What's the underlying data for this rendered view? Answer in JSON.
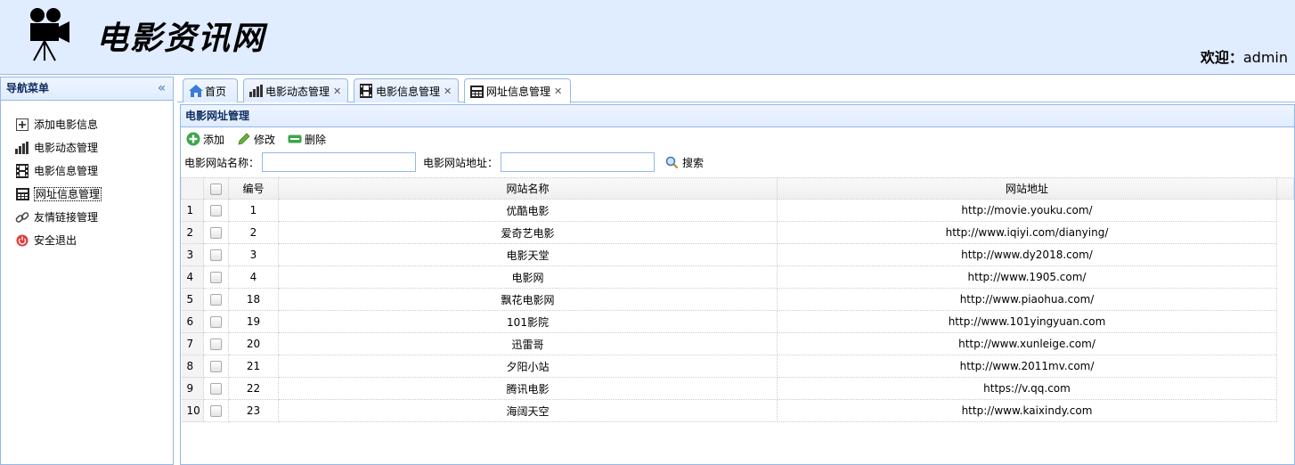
{
  "header": {
    "logo_text": "电影资讯网",
    "welcome_label": "欢迎：",
    "username": "admin"
  },
  "sidebar": {
    "title": "导航菜单",
    "items": [
      {
        "label": "添加电影信息",
        "icon": "add-icon"
      },
      {
        "label": "电影动态管理",
        "icon": "bar-chart-icon"
      },
      {
        "label": "电影信息管理",
        "icon": "film-icon"
      },
      {
        "label": "网址信息管理",
        "icon": "calculator-icon"
      },
      {
        "label": "友情链接管理",
        "icon": "link-icon"
      },
      {
        "label": "安全退出",
        "icon": "exit-icon"
      }
    ]
  },
  "tabs": [
    {
      "label": "首页",
      "icon": "home-icon",
      "closable": false
    },
    {
      "label": "电影动态管理",
      "icon": "bar-chart-icon",
      "closable": true
    },
    {
      "label": "电影信息管理",
      "icon": "film-icon",
      "closable": true
    },
    {
      "label": "网址信息管理",
      "icon": "calculator-icon",
      "closable": true,
      "selected": true
    }
  ],
  "panel": {
    "title": "电影网址管理",
    "toolbar": {
      "add": "添加",
      "edit": "修改",
      "delete": "删除"
    },
    "search": {
      "name_label": "电影网站名称：",
      "name_value": "",
      "url_label": "电影网站地址：",
      "url_value": "",
      "button": "搜索"
    }
  },
  "grid": {
    "columns": [
      "编号",
      "网站名称",
      "网站地址"
    ],
    "rows": [
      {
        "rn": "1",
        "id": "1",
        "name": "优酷电影",
        "url": "http://movie.youku.com/"
      },
      {
        "rn": "2",
        "id": "2",
        "name": "爱奇艺电影",
        "url": "http://www.iqiyi.com/dianying/"
      },
      {
        "rn": "3",
        "id": "3",
        "name": "电影天堂",
        "url": "http://www.dy2018.com/"
      },
      {
        "rn": "4",
        "id": "4",
        "name": "电影网",
        "url": "http://www.1905.com/"
      },
      {
        "rn": "5",
        "id": "18",
        "name": "飘花电影网",
        "url": "http://www.piaohua.com/"
      },
      {
        "rn": "6",
        "id": "19",
        "name": "101影院",
        "url": "http://www.101yingyuan.com"
      },
      {
        "rn": "7",
        "id": "20",
        "name": "迅雷哥",
        "url": "http://www.xunleige.com/"
      },
      {
        "rn": "8",
        "id": "21",
        "name": "夕阳小站",
        "url": "http://www.2011mv.com/"
      },
      {
        "rn": "9",
        "id": "22",
        "name": "腾讯电影",
        "url": "https://v.qq.com"
      },
      {
        "rn": "10",
        "id": "23",
        "name": "海阔天空",
        "url": "http://www.kaixindy.com"
      }
    ]
  }
}
